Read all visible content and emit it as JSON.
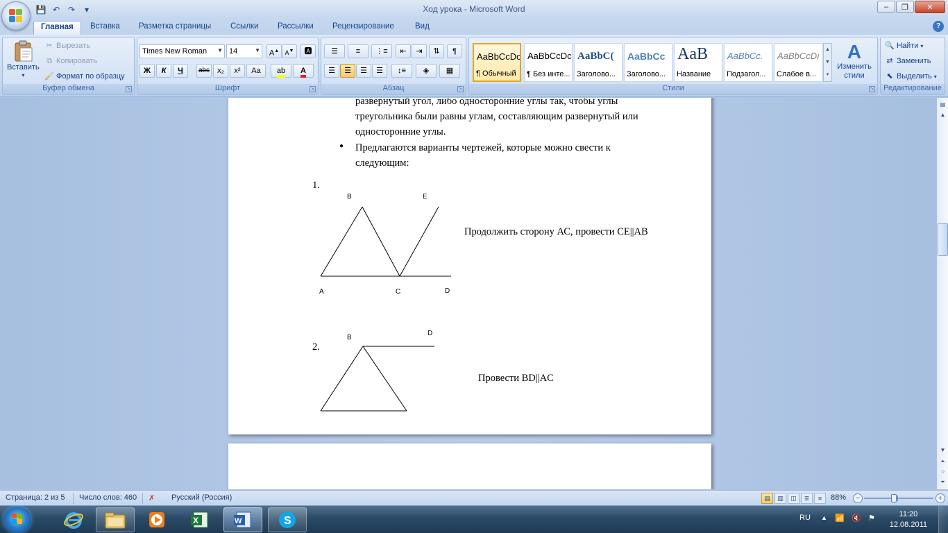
{
  "window": {
    "title": "Ход урока - Microsoft Word",
    "qat": {
      "save": "💾",
      "undo": "↶",
      "redo": "↷",
      "customize": "▾"
    },
    "controls": {
      "minimize": "–",
      "maximize": "❐",
      "close": "✕"
    }
  },
  "tabs": [
    "Главная",
    "Вставка",
    "Разметка страницы",
    "Ссылки",
    "Рассылки",
    "Рецензирование",
    "Вид"
  ],
  "ribbon": {
    "clipboard": {
      "label": "Буфер обмена",
      "paste": "Вставить",
      "cut": "Вырезать",
      "copy": "Копировать",
      "format_painter": "Формат по образцу"
    },
    "font": {
      "label": "Шрифт",
      "font_name": "Times New Roman",
      "font_size": "14",
      "bold": "Ж",
      "italic": "К",
      "underline": "Ч",
      "strike": "abc",
      "subscript": "x₂",
      "superscript": "x²",
      "change_case": "Aa"
    },
    "paragraph": {
      "label": "Абзац",
      "show_marks": "¶"
    },
    "styles": {
      "label": "Стили",
      "items": [
        {
          "sample": "AaBbCcDc",
          "name": "¶ Обычный"
        },
        {
          "sample": "AaBbCcDc",
          "name": "¶ Без инте..."
        },
        {
          "sample": "AaBbC(",
          "name": "Заголово..."
        },
        {
          "sample": "AaBbCc",
          "name": "Заголово..."
        },
        {
          "sample": "AaB",
          "name": "Название"
        },
        {
          "sample": "AaBbCc.",
          "name": "Подзагол..."
        },
        {
          "sample": "AaBbCcDı",
          "name": "Слабое в..."
        }
      ],
      "change_styles": "Изменить стили"
    },
    "editing": {
      "label": "Редактирование",
      "find": "Найти",
      "replace": "Заменить",
      "select": "Выделить"
    }
  },
  "document": {
    "lines": [
      "развернутый угол, либо односторонние углы так, чтобы углы",
      "треугольника были равны углам, составляющим развернутый или",
      "односторонние углы."
    ],
    "bullet_lines": [
      "Предлагаются варианты чертежей, которые можно свести к",
      "следующим:"
    ],
    "figures": [
      {
        "number": "1.",
        "labels": {
          "A": "A",
          "B": "B",
          "C": "C",
          "D": "D",
          "E": "E"
        },
        "caption": "Продолжить сторону АС, провести СЕ||АВ"
      },
      {
        "number": "2.",
        "labels": {
          "B": "B",
          "D": "D"
        },
        "caption": "Провести ВD||AC"
      }
    ]
  },
  "statusbar": {
    "page": "Страница: 2 из 5",
    "words": "Число слов: 460",
    "language": "Русский (Россия)",
    "zoom": "88%",
    "zoom_level": 0.88
  },
  "taskbar": {
    "apps": [
      "internet-explorer",
      "file-explorer",
      "media-player",
      "excel",
      "word",
      "skype"
    ],
    "language": "RU",
    "time": "11:20",
    "date": "12.08.2011"
  }
}
